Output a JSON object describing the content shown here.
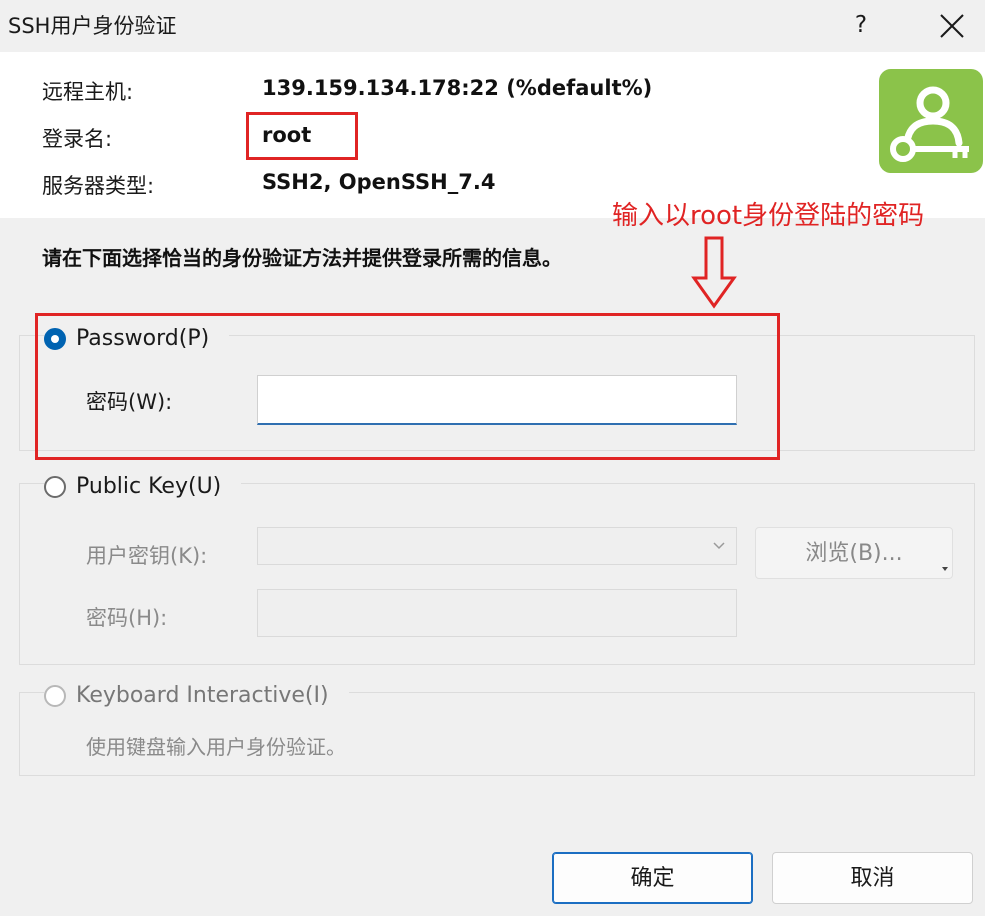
{
  "window": {
    "title": "SSH用户身份验证",
    "help_label": "?"
  },
  "info": {
    "host_label": "远程主机:",
    "host_value": "139.159.134.178:22 (%default%)",
    "login_label": "登录名:",
    "login_value": "root",
    "server_type_label": "服务器类型:",
    "server_type_value": "SSH2, OpenSSH_7.4"
  },
  "annotation": {
    "text": "输入以root身份登陆的密码",
    "color": "#e02424"
  },
  "instruction": "请在下面选择恰当的身份验证方法并提供登录所需的信息。",
  "password_group": {
    "radio_label": "Password(P)",
    "password_field_label": "密码(W):",
    "password_value": ""
  },
  "publickey_group": {
    "radio_label": "Public Key(U)",
    "user_key_label": "用户密钥(K):",
    "user_key_value": "",
    "passphrase_label": "密码(H):",
    "passphrase_value": "",
    "browse_label": "浏览(B)..."
  },
  "keyboard_group": {
    "radio_label": "Keyboard Interactive(I)",
    "description": "使用键盘输入用户身份验证。"
  },
  "buttons": {
    "ok_label": "确定",
    "cancel_label": "取消"
  },
  "colors": {
    "accent": "#0063b1",
    "logo_bg": "#8bc34a",
    "highlight": "#e02424"
  }
}
